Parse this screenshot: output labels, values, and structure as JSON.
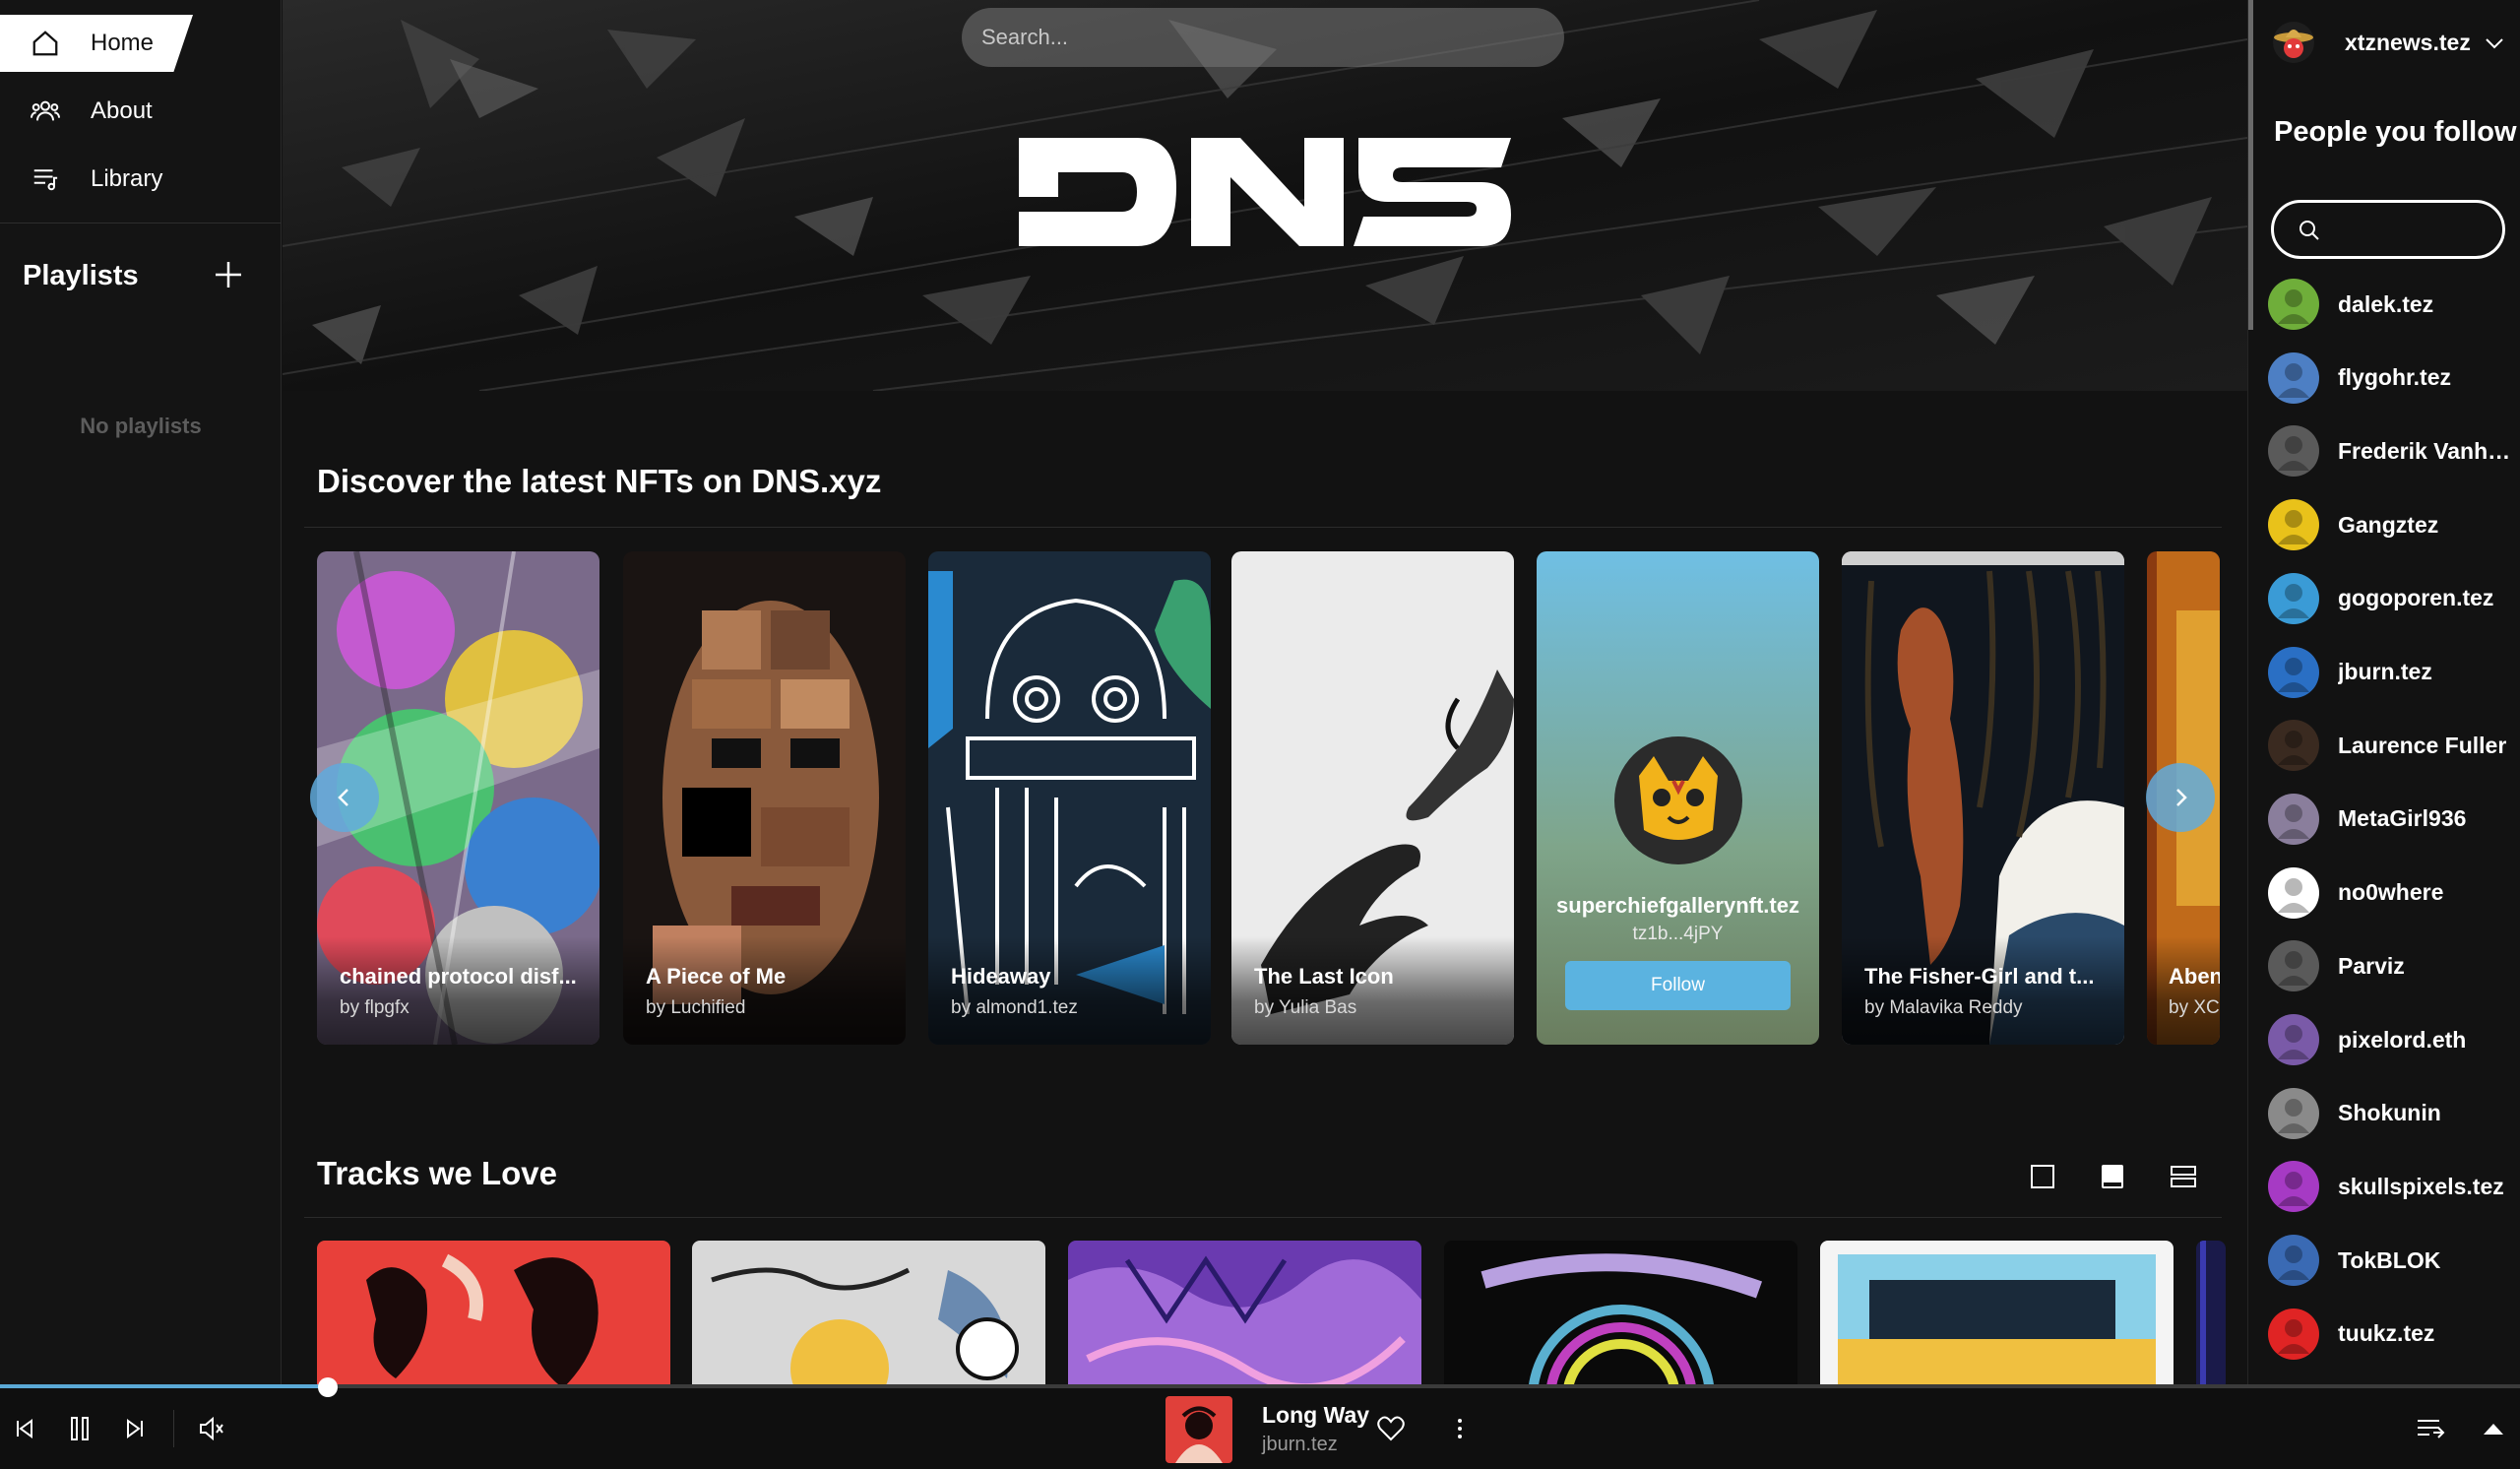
{
  "nav": {
    "items": [
      {
        "label": "Home",
        "icon": "home-icon",
        "active": true
      },
      {
        "label": "About",
        "icon": "people-icon",
        "active": false
      },
      {
        "label": "Library",
        "icon": "library-icon",
        "active": false
      }
    ]
  },
  "playlists": {
    "title": "Playlists",
    "empty_text": "No playlists",
    "add_icon": "plus-icon"
  },
  "header": {
    "search_placeholder": "Search...",
    "logo_text": "DNS"
  },
  "discover": {
    "title": "Discover the latest NFTs on DNS.xyz",
    "cards": [
      {
        "title": "chained protocol disf...",
        "by": "by flpgfx"
      },
      {
        "title": "A Piece of Me",
        "by": "by Luchified"
      },
      {
        "title": "Hideaway",
        "by": "by almond1.tez"
      },
      {
        "title": "The Last Icon",
        "by": "by Yulia Bas"
      },
      {
        "title": "The Fisher-Girl and t...",
        "by": "by Malavika Reddy"
      },
      {
        "title": "Aben",
        "by": "by XC"
      }
    ],
    "profile_card": {
      "name": "superchiefgallerynft.tez",
      "address": "tz1b...4jPY",
      "button": "Follow"
    }
  },
  "tracks": {
    "title": "Tracks we Love",
    "tracks_count": 6
  },
  "account": {
    "username": "xtznews.tez"
  },
  "following": {
    "title": "People you follow",
    "search_placeholder": "",
    "people": [
      {
        "name": "dalek.tez",
        "color": "#6fae3a"
      },
      {
        "name": "flygohr.tez",
        "color": "#4d7fc4"
      },
      {
        "name": "Frederik Vanho...",
        "color": "#5a5a5a"
      },
      {
        "name": "Gangztez",
        "color": "#e9c21a"
      },
      {
        "name": "gogoporen.tez",
        "color": "#3a9bd6"
      },
      {
        "name": "jburn.tez",
        "color": "#2a6fc4"
      },
      {
        "name": "Laurence Fuller",
        "color": "#3a2a20"
      },
      {
        "name": "MetaGirl936",
        "color": "#8a7e9c"
      },
      {
        "name": "no0where",
        "color": "#ffffff"
      },
      {
        "name": "Parviz",
        "color": "#5a5a5a"
      },
      {
        "name": "pixelord.eth",
        "color": "#7a5aa8"
      },
      {
        "name": "Shokunin",
        "color": "#8a8a8a"
      },
      {
        "name": "skullspixels.tez",
        "color": "#a63ac4"
      },
      {
        "name": "TokBLOK",
        "color": "#3a6ab4"
      },
      {
        "name": "tuukz.tez",
        "color": "#e02424"
      }
    ]
  },
  "player": {
    "title": "Long Way",
    "artist": "jburn.tez",
    "progress": 0.13,
    "accent": "#5ba9d6"
  }
}
